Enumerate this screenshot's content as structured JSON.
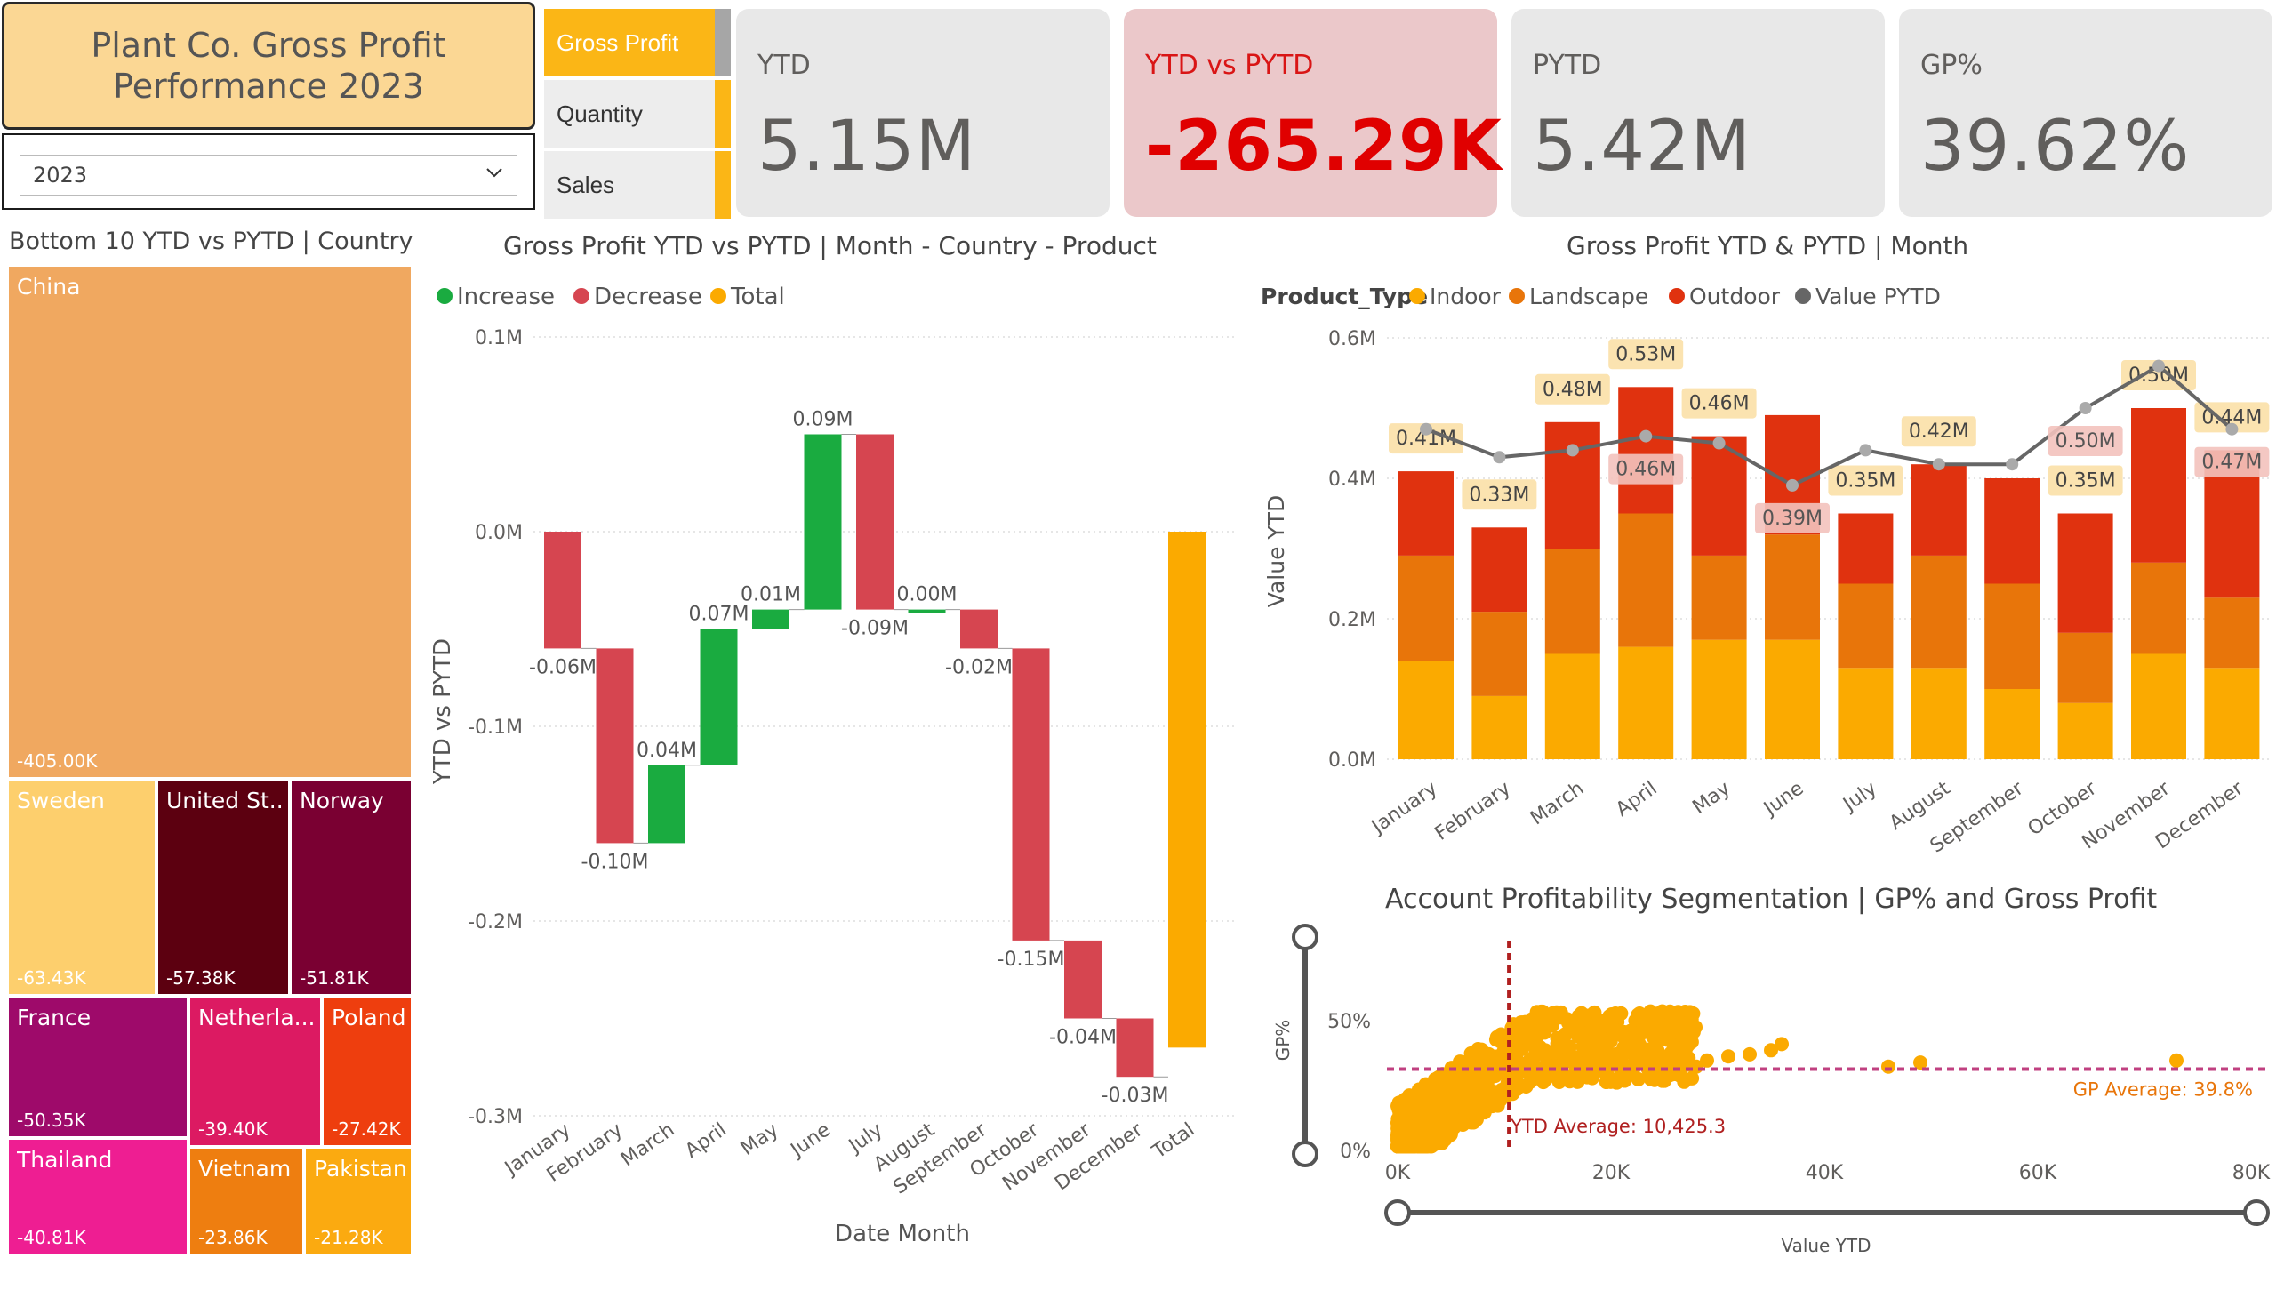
{
  "header": {
    "title_line1": "Plant Co. Gross Profit",
    "title_line2": "Performance 2023"
  },
  "year_slicer": {
    "selected": "2023"
  },
  "measure_buttons": [
    "Gross Profit",
    "Quantity",
    "Sales"
  ],
  "kpis": [
    {
      "label": "YTD",
      "value": "5.15M"
    },
    {
      "label": "YTD vs PYTD",
      "value": "-265.29K"
    },
    {
      "label": "PYTD",
      "value": "5.42M"
    },
    {
      "label": "GP%",
      "value": "39.62%"
    }
  ],
  "colors": {
    "accent": "#fbb616",
    "increase": "#1aab40",
    "decrease": "#d64550",
    "total": "#fbaa00",
    "indoor": "#fbaa00",
    "landscape": "#e8750a",
    "outdoor": "#e0320f",
    "pytd_line": "#666666"
  },
  "treemap": {
    "title": "Bottom 10 YTD vs PYTD | Country",
    "items": [
      {
        "name": "China",
        "value": "-405.00K",
        "color": "#f0a860"
      },
      {
        "name": "Sweden",
        "value": "-63.43K",
        "color": "#fdcf6d"
      },
      {
        "name": "United St...",
        "value": "-57.38K",
        "color": "#5c0010"
      },
      {
        "name": "Norway",
        "value": "-51.81K",
        "color": "#7a0032"
      },
      {
        "name": "France",
        "value": "-50.35K",
        "color": "#9e0a6a"
      },
      {
        "name": "Netherla...",
        "value": "-39.40K",
        "color": "#dc1a62"
      },
      {
        "name": "Poland",
        "value": "-27.42K",
        "color": "#ee3e0e"
      },
      {
        "name": "Thailand",
        "value": "-40.81K",
        "color": "#ee1e92"
      },
      {
        "name": "Vietnam",
        "value": "-23.86K",
        "color": "#ee7e10"
      },
      {
        "name": "Pakistan",
        "value": "-21.28K",
        "color": "#fbaa10"
      }
    ]
  },
  "waterfall": {
    "title": "Gross Profit YTD vs PYTD | Month - Country - Product",
    "legend": [
      "Increase",
      "Decrease",
      "Total"
    ],
    "xlabel": "Date Month",
    "ylabel": "YTD vs PYTD",
    "yticks": [
      "0.1M",
      "0.0M",
      "-0.1M",
      "-0.2M",
      "-0.3M"
    ]
  },
  "stacked": {
    "title": "Gross Profit YTD & PYTD | Month",
    "legend_title": "Product_Type",
    "legend": [
      "Indoor",
      "Landscape",
      "Outdoor",
      "Value PYTD"
    ],
    "ylabel": "Value YTD",
    "yticks": [
      "0.6M",
      "0.4M",
      "0.2M",
      "0.0M"
    ]
  },
  "scatter": {
    "title": "Account Profitability Segmentation | GP% and Gross Profit",
    "xlabel": "Value YTD",
    "ylabel": "GP%",
    "xticks": [
      "0K",
      "20K",
      "40K",
      "60K",
      "80K"
    ],
    "yticks": [
      "50%",
      "0%"
    ],
    "gp_avg_label": "GP Average: 39.8%",
    "ytd_avg_label": "YTD Average: 10,425.3"
  },
  "chart_data": [
    {
      "type": "bar",
      "title": "Gross Profit YTD vs PYTD | Month - Country - Product",
      "xlabel": "Date Month",
      "ylabel": "YTD vs PYTD",
      "ylim": [
        -0.3,
        0.1
      ],
      "categories": [
        "January",
        "February",
        "March",
        "April",
        "May",
        "June",
        "July",
        "August",
        "September",
        "October",
        "November",
        "December",
        "Total"
      ],
      "values": [
        -0.06,
        -0.1,
        0.04,
        0.07,
        0.01,
        0.09,
        -0.09,
        0.0,
        -0.02,
        -0.15,
        -0.04,
        -0.03,
        -0.265
      ],
      "data_labels": [
        "-0.06M",
        "-0.10M",
        "0.04M",
        "0.07M",
        "0.01M",
        "0.09M",
        "-0.09M",
        "0.00M",
        "-0.02M",
        "-0.15M",
        "-0.04M",
        "-0.03M",
        ""
      ]
    },
    {
      "type": "bar",
      "title": "Gross Profit YTD & PYTD | Month",
      "ylabel": "Value YTD",
      "ylim": [
        0,
        0.6
      ],
      "categories": [
        "January",
        "February",
        "March",
        "April",
        "May",
        "June",
        "July",
        "August",
        "September",
        "October",
        "November",
        "December"
      ],
      "series": [
        {
          "name": "Indoor",
          "values": [
            0.14,
            0.09,
            0.15,
            0.16,
            0.17,
            0.17,
            0.13,
            0.13,
            0.1,
            0.08,
            0.15,
            0.13
          ]
        },
        {
          "name": "Landscape",
          "values": [
            0.15,
            0.12,
            0.15,
            0.19,
            0.12,
            0.15,
            0.12,
            0.16,
            0.15,
            0.1,
            0.13,
            0.1
          ]
        },
        {
          "name": "Outdoor",
          "values": [
            0.12,
            0.12,
            0.18,
            0.18,
            0.17,
            0.17,
            0.1,
            0.13,
            0.15,
            0.17,
            0.22,
            0.21
          ]
        },
        {
          "name": "Value PYTD",
          "values": [
            0.47,
            0.43,
            0.44,
            0.46,
            0.45,
            0.39,
            0.44,
            0.42,
            0.42,
            0.5,
            0.56,
            0.47
          ]
        }
      ],
      "data_labels_ytd": [
        "0.41M",
        "0.33M",
        "0.48M",
        "0.53M",
        "0.46M",
        "",
        "0.35M",
        "0.42M",
        "",
        "0.35M",
        "0.50M",
        "0.44M"
      ],
      "data_labels_pytd": [
        "",
        "",
        "",
        "0.46M",
        "",
        "0.39M",
        "",
        "",
        "",
        "0.50M",
        "",
        "0.47M"
      ]
    },
    {
      "type": "scatter",
      "title": "Account Profitability Segmentation | GP% and Gross Profit",
      "xlabel": "Value YTD",
      "ylabel": "GP%",
      "xlim": [
        0,
        80000
      ],
      "ylim": [
        0,
        0.7
      ],
      "reference_lines": {
        "gp_average": 0.398,
        "ytd_average": 10425.3
      },
      "points": [
        [
          46000,
          0.41
        ],
        [
          49000,
          0.43
        ],
        [
          73000,
          0.44
        ],
        [
          36000,
          0.52
        ],
        [
          35000,
          0.49
        ],
        [
          33000,
          0.47
        ],
        [
          31000,
          0.46
        ],
        [
          29000,
          0.44
        ],
        [
          28000,
          0.41
        ]
      ]
    }
  ]
}
